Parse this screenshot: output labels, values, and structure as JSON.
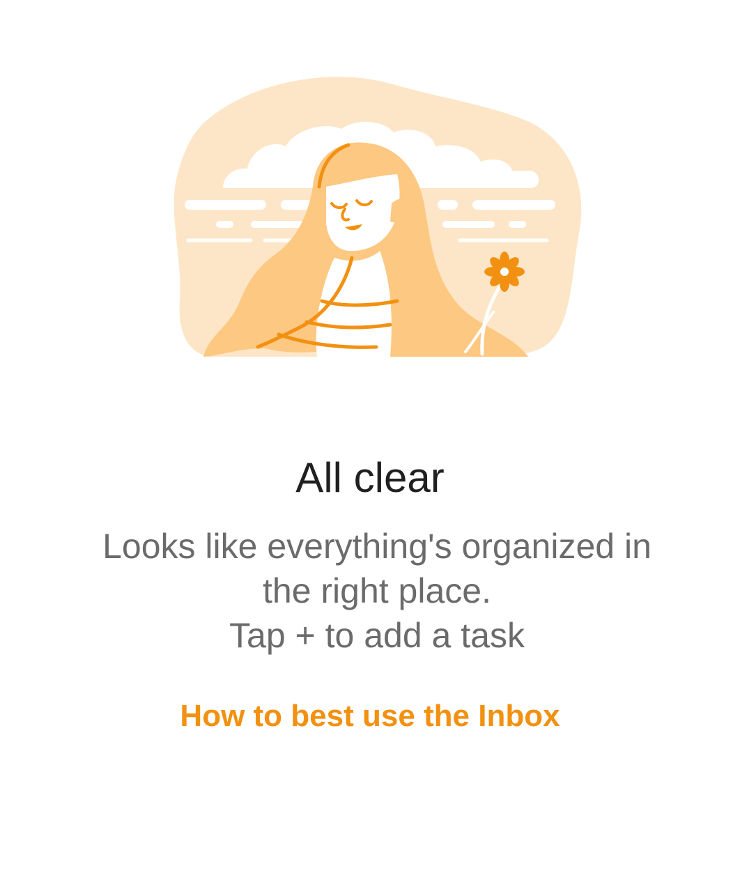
{
  "empty_state": {
    "illustration_icon": "woman-with-flower-illustration",
    "title": "All clear",
    "message_line1": "Looks like everything's organized in",
    "message_line2": "the right place.",
    "message_line3": "Tap + to add a task",
    "link_label": "How to best use the Inbox"
  },
  "colors": {
    "accent": "#f29111",
    "illustration_light": "#fde6c8",
    "illustration_mid": "#fdc882",
    "text_primary": "#202020",
    "text_secondary": "#6b6b6b"
  }
}
